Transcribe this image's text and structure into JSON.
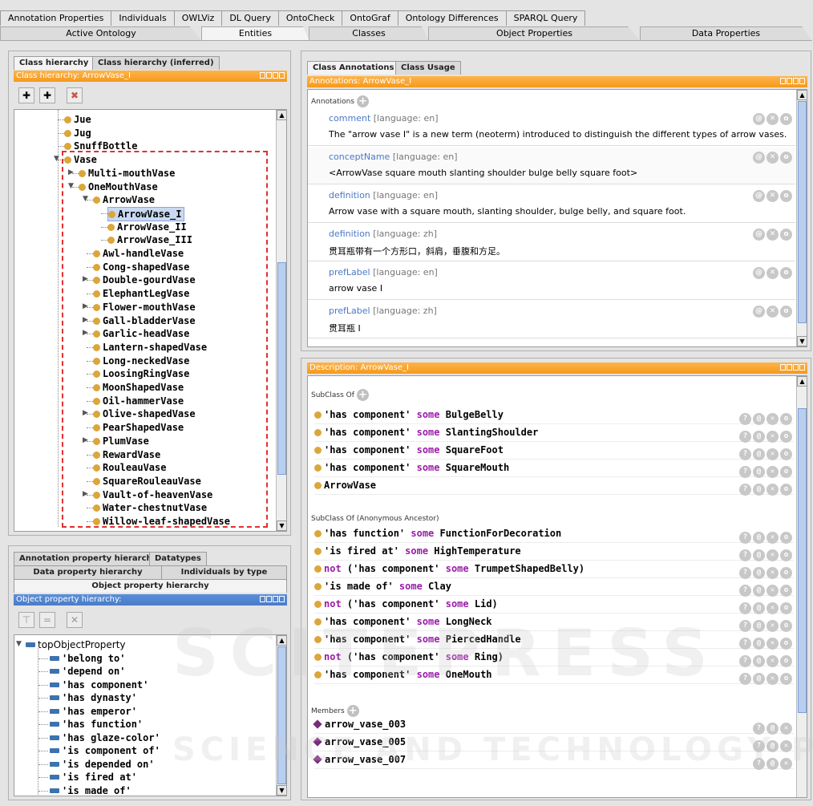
{
  "top_tabs": [
    "Annotation Properties",
    "Individuals",
    "OWLViz",
    "DL Query",
    "OntoCheck",
    "OntoGraf",
    "Ontology Differences",
    "SPARQL Query"
  ],
  "main_tabs": [
    "Active Ontology",
    "Entities",
    "Classes",
    "Object Properties",
    "Data Properties"
  ],
  "left_top": {
    "tabs": [
      "Class hierarchy",
      "Class hierarchy (inferred)"
    ],
    "title": "Class hierarchy: ArrowVase_I",
    "items": [
      "Jue",
      "Jug",
      "SnuffBottle",
      "Vase",
      "Multi-mouthVase",
      "OneMouthVase",
      "ArrowVase",
      "ArrowVase_I",
      "ArrowVase_II",
      "ArrowVase_III",
      "Awl-handleVase",
      "Cong-shapedVase",
      "Double-gourdVase",
      "ElephantLegVase",
      "Flower-mouthVase",
      "Gall-bladderVase",
      "Garlic-headVase",
      "Lantern-shapedVase",
      "Long-neckedVase",
      "LoosingRingVase",
      "MoonShapedVase",
      "Oil-hammerVase",
      "Olive-shapedVase",
      "PearShapedVase",
      "PlumVase",
      "RewardVase",
      "RouleauVase",
      "SquareRouleauVase",
      "Vault-of-heavenVase",
      "Water-chestnutVase",
      "Willow-leaf-shapedVase"
    ]
  },
  "left_bottom": {
    "tabs_row1": [
      "Annotation property hierarchy",
      "Datatypes"
    ],
    "tabs_row2": [
      "Data property hierarchy",
      "Individuals by type"
    ],
    "tabs_row3": [
      "Object property hierarchy"
    ],
    "title": "Object property hierarchy:",
    "items": [
      "topObjectProperty",
      "'belong to'",
      "'depend on'",
      "'has component'",
      "'has dynasty'",
      "'has emperor'",
      "'has function'",
      "'has glaze-color'",
      "'is component of'",
      "'is depended on'",
      "'is fired at'",
      "'is made of'"
    ]
  },
  "annotations": {
    "tabs": [
      "Class Annotations",
      "Class Usage"
    ],
    "title": "Annotations: ArrowVase_I",
    "header": "Annotations",
    "rows": [
      {
        "prop": "comment",
        "lang": "[language: en]",
        "value": "The \"arrow vase I\" is a new term (neoterm) introduced to distinguish the different types of arrow vases."
      },
      {
        "prop": "conceptName",
        "lang": "[language: en]",
        "value": "<ArrowVase square mouth slanting shoulder bulge belly square foot>"
      },
      {
        "prop": "definition",
        "lang": "[language: en]",
        "value": "Arrow vase with a square mouth, slanting shoulder, bulge belly, and square foot."
      },
      {
        "prop": "definition",
        "lang": "[language: zh]",
        "value": "贯耳瓶带有一个方形口，斜肩，垂腹和方足。"
      },
      {
        "prop": "prefLabel",
        "lang": "[language: en]",
        "value": "arrow vase I"
      },
      {
        "prop": "prefLabel",
        "lang": "[language: zh]",
        "value": "贯耳瓶 I"
      }
    ]
  },
  "description": {
    "title": "Description: ArrowVase_I",
    "subclass_hdr": "SubClass Of",
    "subclass": [
      {
        "pre": "'has component' ",
        "kw": "some",
        "post": " BulgeBelly"
      },
      {
        "pre": "'has component' ",
        "kw": "some",
        "post": " SlantingShoulder"
      },
      {
        "pre": "'has component' ",
        "kw": "some",
        "post": " SquareFoot"
      },
      {
        "pre": "'has component' ",
        "kw": "some",
        "post": " SquareMouth"
      },
      {
        "pre": "ArrowVase",
        "kw": "",
        "post": ""
      }
    ],
    "anon_hdr": "SubClass Of (Anonymous Ancestor)",
    "anon": [
      {
        "neg": "",
        "pre": "'has function' ",
        "kw": "some",
        "post": " FunctionForDecoration"
      },
      {
        "neg": "",
        "pre": "'is fired at' ",
        "kw": "some",
        "post": " HighTemperature"
      },
      {
        "neg": "not",
        "pre": " ('has component' ",
        "kw": "some",
        "post": " TrumpetShapedBelly)"
      },
      {
        "neg": "",
        "pre": "'is made of' ",
        "kw": "some",
        "post": " Clay"
      },
      {
        "neg": "not",
        "pre": " ('has component' ",
        "kw": "some",
        "post": " Lid)"
      },
      {
        "neg": "",
        "pre": "'has component' ",
        "kw": "some",
        "post": " LongNeck"
      },
      {
        "neg": "",
        "pre": "'has component' ",
        "kw": "some",
        "post": " PiercedHandle"
      },
      {
        "neg": "not",
        "pre": " ('has component' ",
        "kw": "some",
        "post": " Ring)"
      },
      {
        "neg": "",
        "pre": "'has component' ",
        "kw": "some",
        "post": " OneMouth"
      }
    ],
    "members_hdr": "Members",
    "members": [
      "arrow_vase_003",
      "arrow_vase_005",
      "arrow_vase_007"
    ]
  },
  "watermark": "SCITEPRESS",
  "watermark2": "SCIENCE AND TECHNOLOGY PUBLICATIONS",
  "colors": {
    "blue_title": "#4a7cc8",
    "orange_title": "#f49a1e",
    "keyword": "#9a1ca8",
    "class_dot": "#dba63a"
  }
}
